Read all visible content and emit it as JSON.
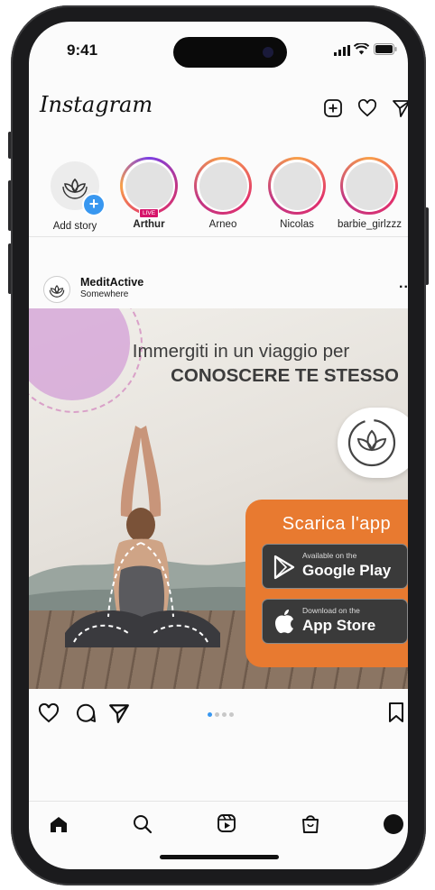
{
  "status": {
    "time": "9:41"
  },
  "header": {
    "logo": "Instagram",
    "icons": [
      "new-post-icon",
      "heart-icon",
      "direct-message-icon"
    ]
  },
  "stories": [
    {
      "name": "Add story",
      "type": "add"
    },
    {
      "name": "Arthur",
      "live": "LIVE",
      "bold": true
    },
    {
      "name": "Arneo"
    },
    {
      "name": "Nicolas"
    },
    {
      "name": "barbie_girlzzz"
    }
  ],
  "post": {
    "author": "MeditActive",
    "location": "Somewhere",
    "more": "...",
    "headline_1": "Immergiti in un viaggio per",
    "headline_2": "CONOSCERE TE STESSO",
    "cta_title": "Scarica l'app",
    "google_small": "Available on the",
    "google_big": "Google Play",
    "apple_small": "Download on the",
    "apple_big": "App Store",
    "carousel_count": 4,
    "carousel_active": 1
  },
  "colors": {
    "accent_orange": "#e87a30",
    "cta_dark": "#3a3a3a",
    "live_badge": "#d6146a",
    "carousel_active": "#3897f0",
    "circle_pink": "#d6a8d8"
  },
  "tabbar": [
    "home-icon",
    "search-icon",
    "reels-icon",
    "shop-icon",
    "profile-icon"
  ]
}
